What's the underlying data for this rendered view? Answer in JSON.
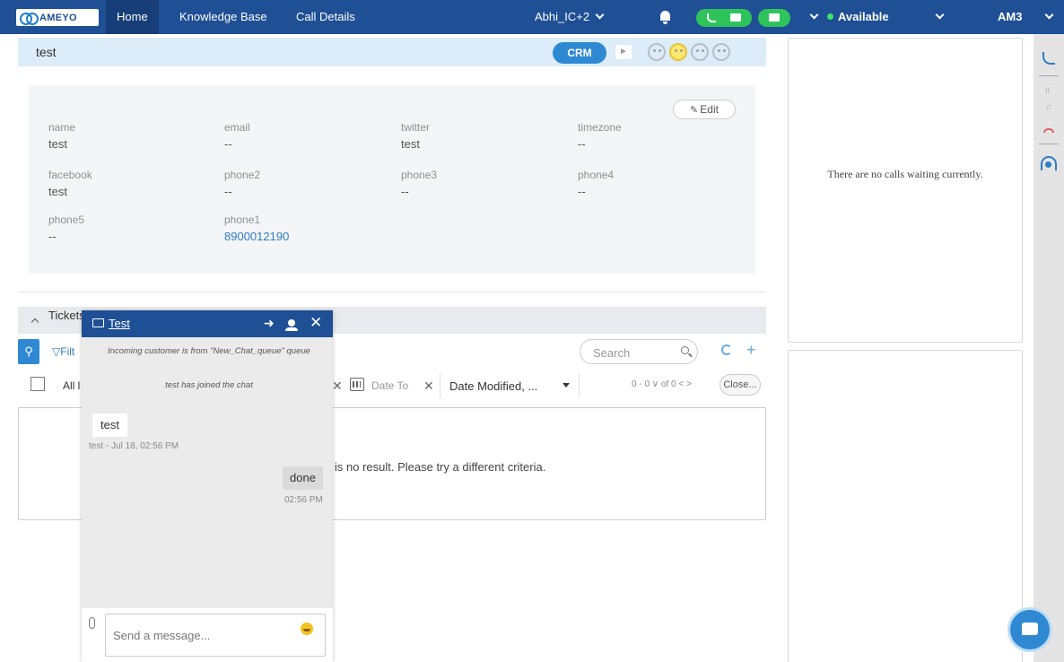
{
  "app": {
    "logo_text": "AMEYO",
    "nav": {
      "home": "Home",
      "knowledge_base": "Knowledge Base",
      "call_details": "Call Details"
    },
    "campaign": "Abhi_IC+2",
    "status": "Available",
    "agent": "AM3",
    "colors": {
      "topbar": "#1f4f94",
      "accent": "#2e89d2",
      "green": "#2fc45b"
    }
  },
  "contact": {
    "name": "test",
    "crm_label": "CRM",
    "edit_label": "Edit",
    "fields": [
      {
        "label": "name",
        "value": "test"
      },
      {
        "label": "email",
        "value": "--"
      },
      {
        "label": "twitter",
        "value": "test"
      },
      {
        "label": "timezone",
        "value": "--"
      },
      {
        "label": "facebook",
        "value": "test"
      },
      {
        "label": "phone2",
        "value": "--"
      },
      {
        "label": "phone3",
        "value": "--"
      },
      {
        "label": "phone4",
        "value": "--"
      },
      {
        "label": "phone5",
        "value": "--"
      },
      {
        "label": "phone1",
        "value": "8900012190"
      }
    ]
  },
  "tickets": {
    "title": "Tickets",
    "filter_label": "Filt",
    "search_placeholder": "Search",
    "all_label": "All l",
    "date_to": "Date To",
    "sort": "Date Modified, ...",
    "pager": "0 - 0 ∨ of 0  <  >",
    "close_label": "Close...",
    "no_result": "is no result. Please try a different criteria."
  },
  "right": {
    "no_calls": "There are no calls waiting currently."
  },
  "chat": {
    "title": "Test",
    "system_messages": [
      "Incoming customer is from \"New_Chat_queue\" queue",
      "test has joined the chat"
    ],
    "incoming": {
      "text": "test",
      "meta": "test - Jul 18, 02:56 PM"
    },
    "outgoing": {
      "text": "done",
      "meta": "02:56 PM"
    },
    "input_placeholder": "Send a message..."
  }
}
